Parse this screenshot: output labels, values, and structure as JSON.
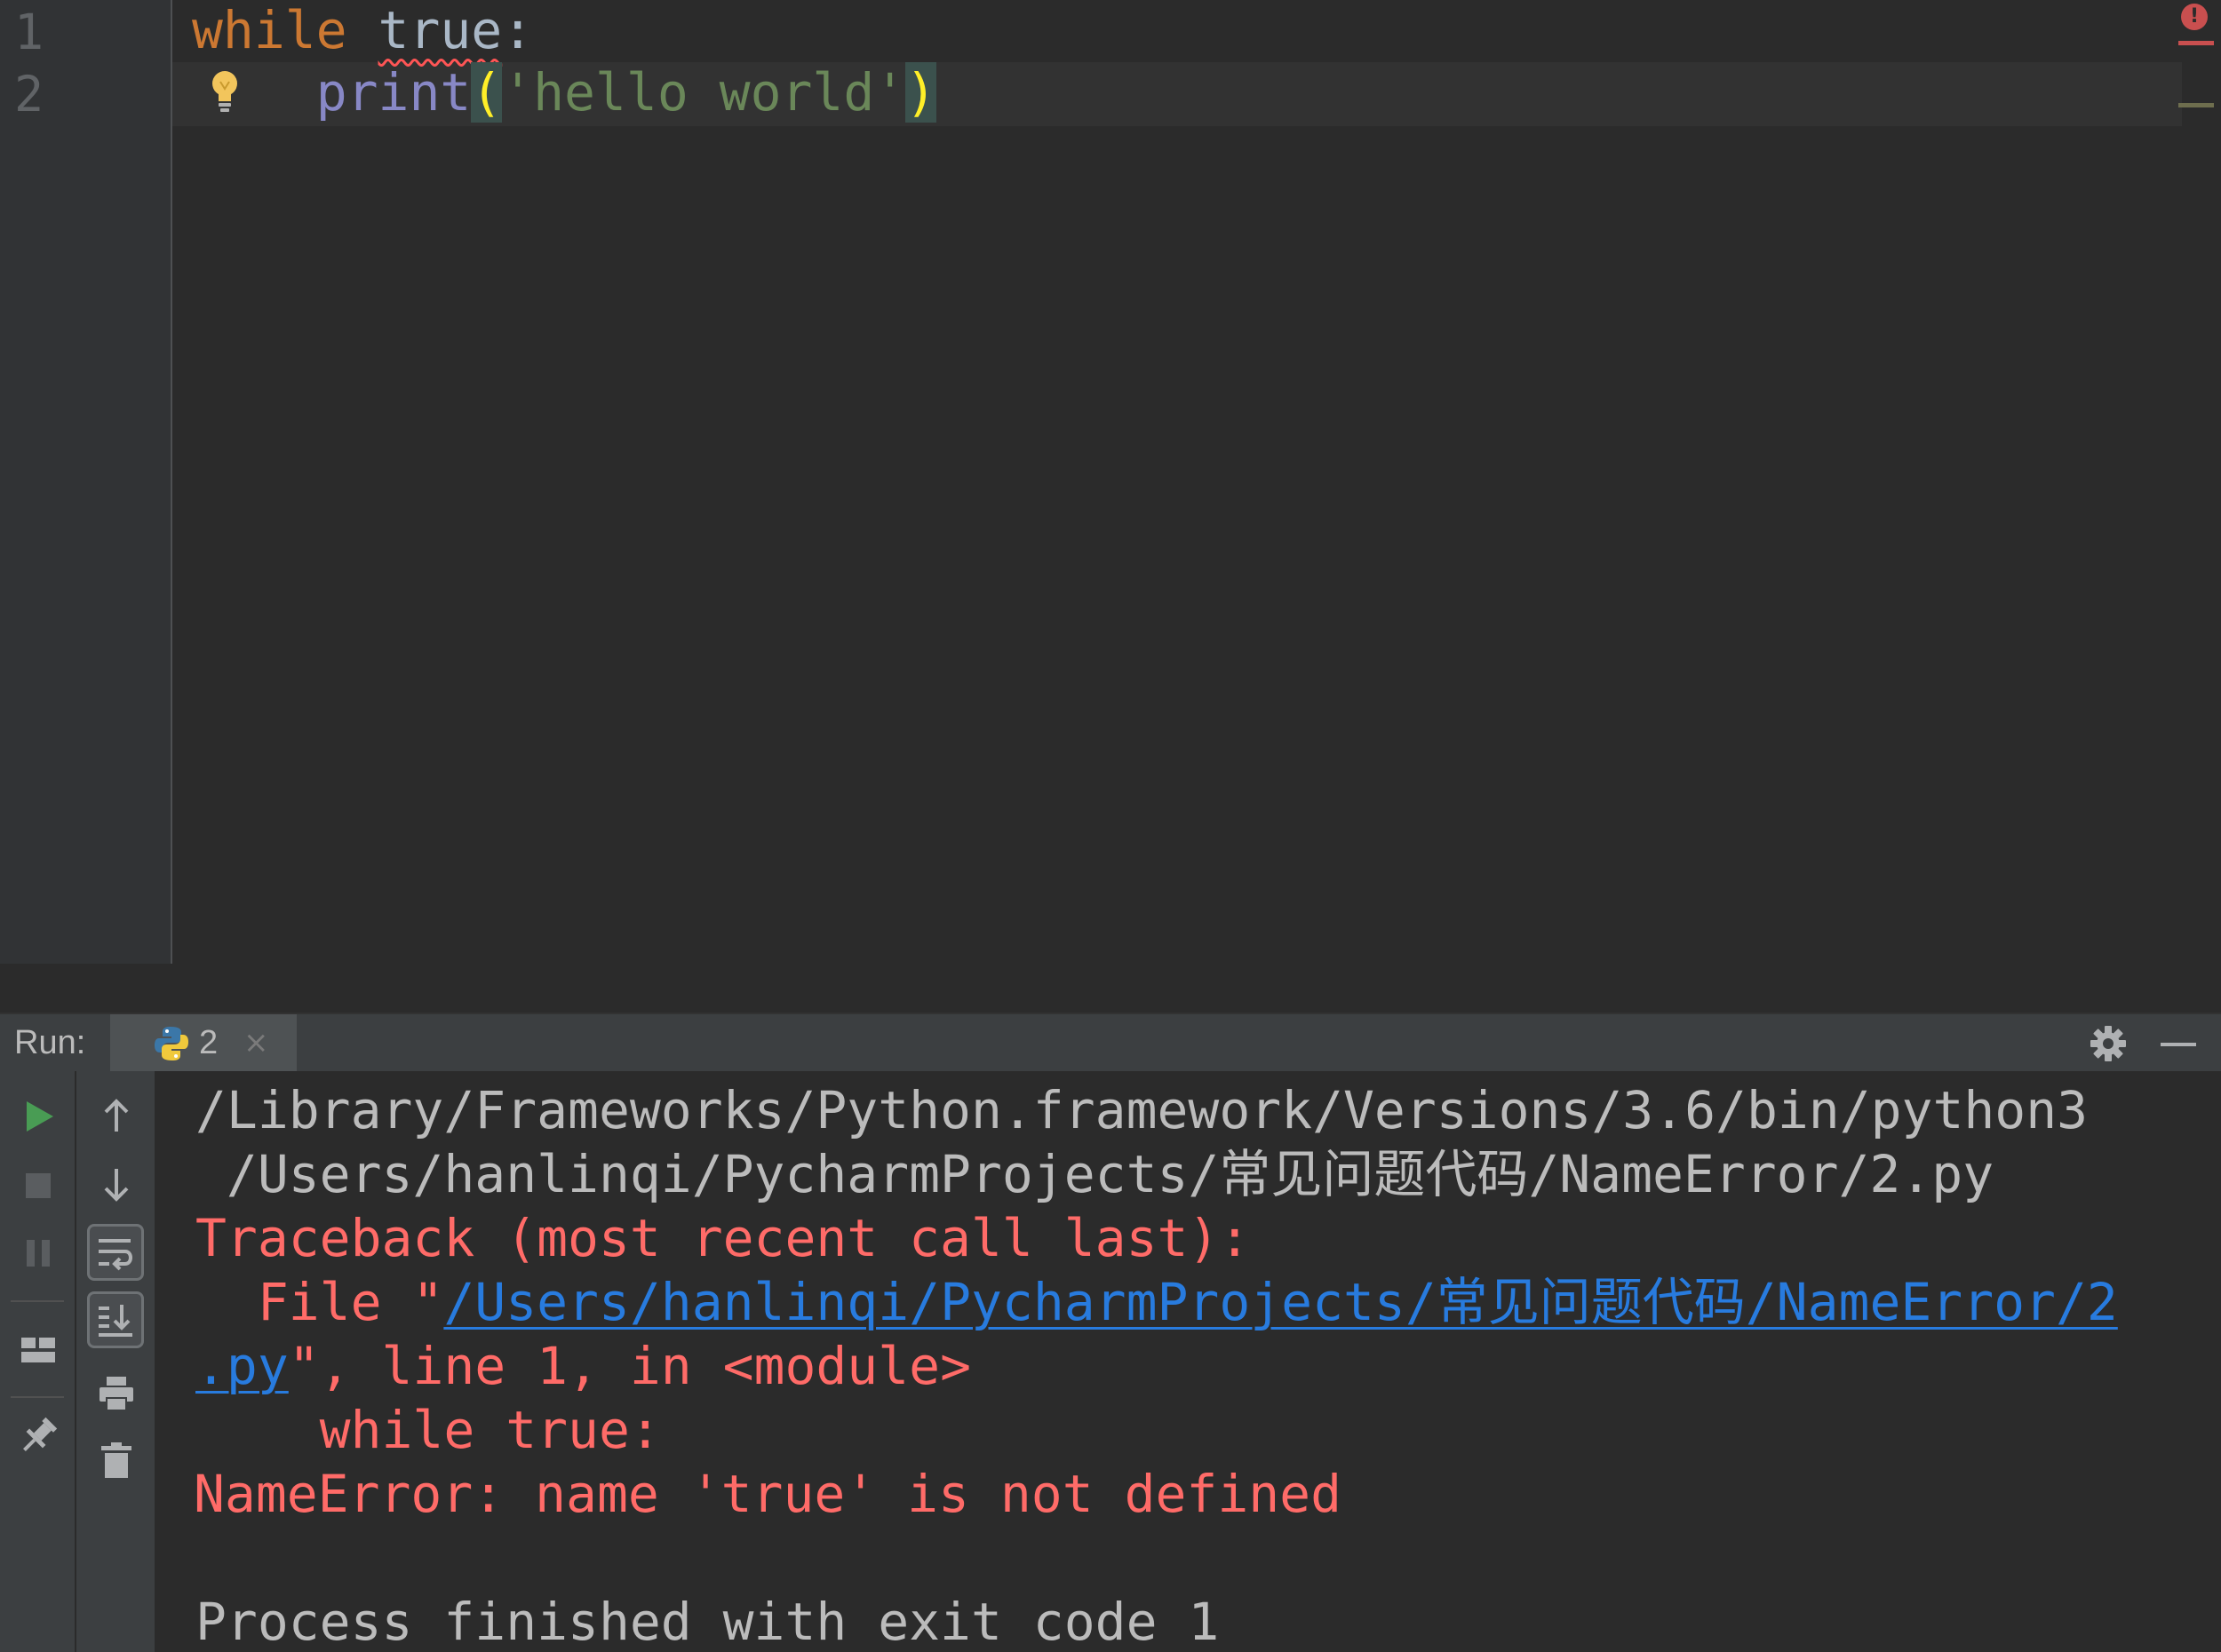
{
  "editor": {
    "line_numbers": [
      "1",
      "2"
    ],
    "line1": {
      "keyword": "while",
      "name": "true",
      "colon": ":"
    },
    "line2": {
      "indent": "    ",
      "func": "print",
      "open_paren": "(",
      "string": "'hello world'",
      "close_paren": ")"
    },
    "colors": {
      "keyword": "#cc7832",
      "builtin": "#8888c6",
      "string": "#6a8759",
      "error": "#ff5555"
    }
  },
  "run_panel": {
    "label": "Run:",
    "tab": {
      "label": "2",
      "icon": "python-icon",
      "close": "×"
    },
    "icons": {
      "header": [
        "gear-icon",
        "minimize-icon"
      ],
      "left": [
        "run-icon",
        "stop-icon",
        "pause-icon",
        "layout-icon",
        "pin-icon"
      ],
      "right": [
        "up-arrow-icon",
        "down-arrow-icon",
        "soft-wrap-icon",
        "scroll-to-end-icon",
        "print-icon",
        "trash-icon"
      ]
    }
  },
  "console": {
    "cmd_line1": "/Library/Frameworks/Python.framework/Versions/3.6/bin/python3",
    "cmd_line2": " /Users/hanlinqi/PycharmProjects/常见问题代码/NameError/2.py",
    "traceback_header": "Traceback (most recent call last):",
    "file_prefix": "  File \"",
    "file_link_part1": "/Users/hanlinqi/PycharmProjects/常见问题代码/NameError/2",
    "file_link_part2": ".py",
    "file_suffix": "\", line 1, in <module>",
    "code_context": "    while true:",
    "error_message": "NameError: name 'true' is not defined",
    "exit_message": "Process finished with exit code 1",
    "colors": {
      "normal": "#bbbbbb",
      "error": "#ff6b68",
      "link": "#287bde"
    }
  }
}
